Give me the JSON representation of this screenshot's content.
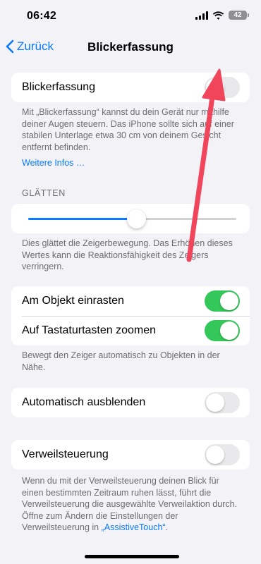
{
  "status_bar": {
    "time": "06:42",
    "battery_level": "42",
    "icons": [
      "signal-icon",
      "wifi-icon",
      "battery-icon"
    ]
  },
  "nav": {
    "back_label": "Zurück",
    "title": "Blickerfassung"
  },
  "colors": {
    "accent": "#0a7aff",
    "toggle_on": "#34c759",
    "toggle_off": "#e9e9eb",
    "background": "#f2f2f7",
    "annotation_arrow": "#f0455a"
  },
  "eye_tracking": {
    "label": "Blickerfassung",
    "enabled": false,
    "description": "Mit „Blickerfassung“ kannst du dein Gerät nur mithilfe deiner Augen steuern. Das iPhone sollte sich auf einer stabilen Unterlage etwa 30 cm von deinem Gesicht entfernt befinden.",
    "more_info_link": "Weitere Infos …"
  },
  "smoothing": {
    "header": "GLÄTTEN",
    "slider_value_fraction": 0.52,
    "description": "Dies glättet die Zeigerbewegung. Das Erhöhen dieses Wertes kann die Reaktionsfähigkeit des Zeigers verringern."
  },
  "snap_group": {
    "snap_to_item_label": "Am Objekt einrasten",
    "snap_to_item_enabled": true,
    "zoom_keyboard_label": "Auf Tastaturtasten zoomen",
    "zoom_keyboard_enabled": true,
    "description": "Bewegt den Zeiger automatisch zu Objekten in der Nähe."
  },
  "auto_hide": {
    "label": "Automatisch ausblenden",
    "enabled": false
  },
  "dwell": {
    "label": "Verweilsteuerung",
    "enabled": false,
    "description_prefix": "Wenn du mit der Verweilsteuerung deinen Blick für einen bestimmten Zeitraum ruhen lässt, führt die Verweilsteuerung die ausgewählte Verweilaktion durch. Öffne zum Ändern die Einstellungen der Verweilsteuerung in ",
    "description_link": "„AssistiveTouch“",
    "description_suffix": "."
  }
}
